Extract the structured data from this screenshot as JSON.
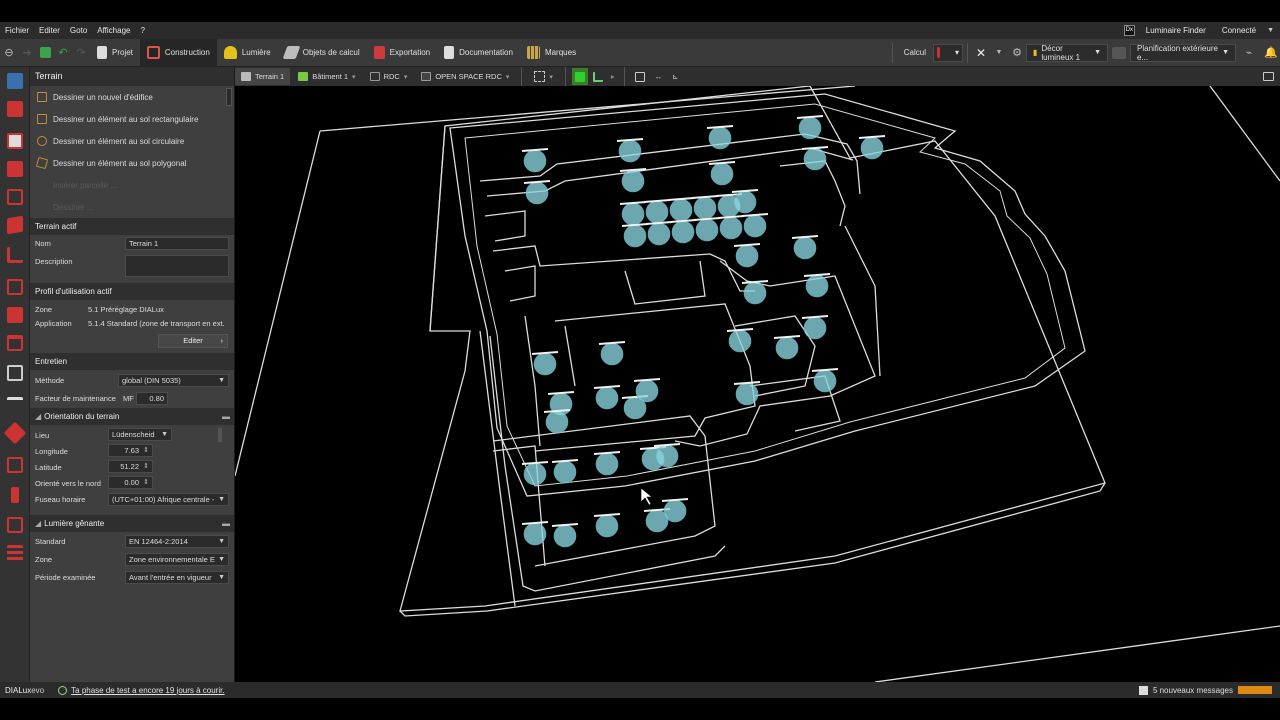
{
  "menu": {
    "items": [
      "Fichier",
      "Editer",
      "Goto",
      "Affichage",
      "?"
    ],
    "luminaire_finder": "Luminaire Finder",
    "account": "Connecté",
    "dlx_badge": "Dx"
  },
  "ribbon": {
    "tabs": [
      {
        "label": "Projet",
        "color": "#dddddd"
      },
      {
        "label": "Construction",
        "color": "#d9534f"
      },
      {
        "label": "Lumière",
        "color": "#e3c21a"
      },
      {
        "label": "Objets de calcul",
        "color": "#cfcfcf"
      },
      {
        "label": "Exportation",
        "color": "#cf3a3a"
      },
      {
        "label": "Documentation",
        "color": "#dddddd"
      },
      {
        "label": "Marques",
        "color": "#c9a64a"
      }
    ],
    "active_tab": "Construction",
    "calc_label": "Calcul",
    "scene_select": "Décor lumineux 1",
    "planning_select": "Planification extérieure e..."
  },
  "view_tabs": [
    {
      "label": "Terrain 1",
      "color": "#bbbbbb"
    },
    {
      "label": "Bâtiment 1",
      "color": "#7ac943"
    },
    {
      "label": "RDC",
      "color": "#9a9a9a"
    },
    {
      "label": "OPEN SPACE RDC",
      "color": "#9a9a9a"
    }
  ],
  "panel": {
    "title": "Terrain",
    "actions": [
      "Dessiner un nouvel d'édifice",
      "Dessiner un élément au sol rectangulaire",
      "Dessiner un élément au sol circulaire",
      "Dessiner un élément au sol polygonal"
    ],
    "disabled_actions": [
      "Insérer parcelle ...",
      "Dessiner ..."
    ],
    "active_terrain": {
      "header": "Terrain actif",
      "name_label": "Nom",
      "name_value": "Terrain 1",
      "description_label": "Description",
      "description_value": ""
    },
    "usage_profile": {
      "header": "Profil d'utilisation actif",
      "zone_label": "Zone",
      "zone_value": "5.1 Préréglage DIALux",
      "application_label": "Application",
      "application_value": "5.1.4 Standard (zone de transport en ext.",
      "edit_button": "Editer"
    },
    "maintenance": {
      "header": "Entretien",
      "method_label": "Méthode",
      "method_value": "global (DIN 5035)",
      "factor_label": "Facteur de maintenance",
      "factor_prefix": "MF",
      "factor_value": "0.80"
    },
    "orientation": {
      "header": "Orientation du terrain",
      "place_label": "Lieu",
      "place_value": "Lüdenscheid",
      "longitude_label": "Longitude",
      "longitude_value": "7.63",
      "latitude_label": "Latitude",
      "latitude_value": "51.22",
      "north_label": "Orienté vers le nord",
      "north_value": "0.00",
      "tz_label": "Fuseau horaire",
      "tz_value": "(UTC+01:00) Afrique centrale -"
    },
    "glare": {
      "header": "Lumière gênante",
      "standard_label": "Standard",
      "standard_value": "EN 12464-2:2014",
      "zone_label": "Zone",
      "zone_value": "Zone environnementale E",
      "period_label": "Période examinée",
      "period_value": "Avant l'entrée en vigueur"
    }
  },
  "status": {
    "logo_a": "DIALux",
    "logo_b": "evo",
    "trial": "Ta phase de test a encore 19 jours à courir.",
    "messages": "5 nouveaux messages"
  }
}
